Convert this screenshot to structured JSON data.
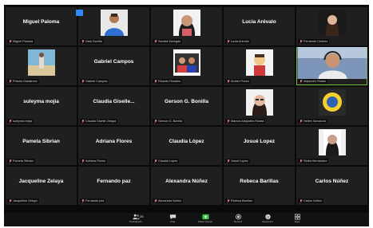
{
  "grid": {
    "tiles": [
      {
        "kind": "name",
        "big": "Miguel Paloma",
        "caption": "Miguel Paloma"
      },
      {
        "kind": "photo",
        "big": "",
        "caption": "Zack Bonilla",
        "photo": "man-blue"
      },
      {
        "kind": "photo",
        "big": "",
        "caption": "Sandra Vanegas",
        "photo": "woman-dark"
      },
      {
        "kind": "name",
        "big": "Lucia Arévalo",
        "caption": "Lucia Arévalo"
      },
      {
        "kind": "photo",
        "big": "",
        "caption": "Fernando Chávez",
        "photo": "woman-long"
      },
      {
        "kind": "photo",
        "big": "",
        "caption": "Priscila Galdámez",
        "photo": "beach"
      },
      {
        "kind": "name",
        "big": "Gabriel Campos",
        "caption": "Gabriel Campos"
      },
      {
        "kind": "photo",
        "big": "",
        "caption": "Ricardo Rosales",
        "photo": "group"
      },
      {
        "kind": "photo",
        "big": "",
        "caption": "Amber Flores",
        "photo": "cartoon"
      },
      {
        "kind": "photo",
        "big": "",
        "caption": "Alejandro Rodas",
        "photo": "man-headset",
        "speaking": true
      },
      {
        "kind": "name",
        "big": "sulеyma mojia",
        "caption": "sulеyma mejia"
      },
      {
        "kind": "name",
        "big": "Claudia Giselle...",
        "caption": "Claudia Giselle Zelaya"
      },
      {
        "kind": "name",
        "big": "Gerson G. Bonilla",
        "caption": "Gerson G. Bonilla"
      },
      {
        "kind": "photo",
        "big": "",
        "caption": "Marcos Alejandro Rodas",
        "photo": "woman-glasses"
      },
      {
        "kind": "photo",
        "big": "",
        "caption": "Hellen Sandoval",
        "photo": "logo"
      },
      {
        "kind": "name",
        "big": "Pamela Sibrian",
        "caption": "Pamela Sibrian"
      },
      {
        "kind": "name",
        "big": "Adriana Flores",
        "caption": "Adriana Flores"
      },
      {
        "kind": "name",
        "big": "Claudia López",
        "caption": "Claudia López"
      },
      {
        "kind": "name",
        "big": "Josué Lopez",
        "caption": "Josué Lopez"
      },
      {
        "kind": "photo",
        "big": "",
        "caption": "Stella Hernández",
        "photo": "portrait"
      },
      {
        "kind": "name",
        "big": "Jacqueline Zelaya",
        "caption": "Jacqueline Zelaya"
      },
      {
        "kind": "name",
        "big": "Fernando paz",
        "caption": "Fernando paz"
      },
      {
        "kind": "name",
        "big": "Alexandra Núñez",
        "caption": "Alexandra Núñez"
      },
      {
        "kind": "name",
        "big": "Rebeca Barillas",
        "caption": "Rebeca Barillas"
      },
      {
        "kind": "name",
        "big": "Carlos Núñez",
        "caption": "Carlos Núñez"
      }
    ]
  },
  "toolbar": {
    "participants_count": "25",
    "participants_label": "Participants",
    "chat_label": "Chat",
    "share_label": "Share Screen",
    "record_label": "Record",
    "reactions_label": "Reactions",
    "apps_label": "Apps"
  },
  "colors": {
    "share_green": "#3cc43c",
    "speaking_border": "#6fbf3a",
    "mute_red": "#e02f2f",
    "view_badge": "#2d8cff"
  }
}
